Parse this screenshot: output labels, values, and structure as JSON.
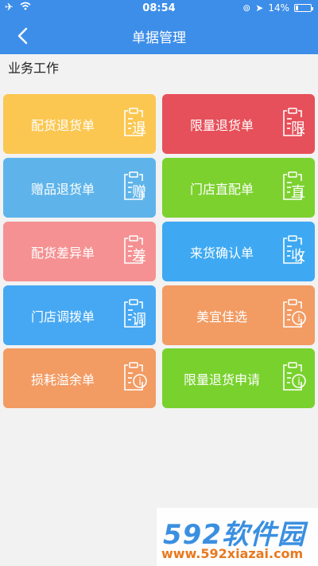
{
  "status_bar": {
    "time": "08:54",
    "battery": "14%"
  },
  "header": {
    "title": "单据管理"
  },
  "section": {
    "title": "业务工作"
  },
  "cards": [
    {
      "label": "配货退货单",
      "glyph": "退",
      "color": "#fbc751"
    },
    {
      "label": "限量退货单",
      "glyph": "限",
      "color": "#e6505a"
    },
    {
      "label": "赠品退货单",
      "glyph": "赠",
      "color": "#5eb4ea"
    },
    {
      "label": "门店直配单",
      "glyph": "直",
      "color": "#7cd12f"
    },
    {
      "label": "配货差异单",
      "glyph": "差",
      "color": "#f59192"
    },
    {
      "label": "来货确认单",
      "glyph": "收",
      "color": "#3ea9f2"
    },
    {
      "label": "门店调拨单",
      "glyph": "调",
      "color": "#46a8f2"
    },
    {
      "label": "美宜佳选",
      "glyph": "i",
      "color": "#f29b63"
    },
    {
      "label": "损耗溢余单",
      "glyph": "i",
      "color": "#f29b63"
    },
    {
      "label": "限量退货申请",
      "glyph": "i",
      "color": "#79d12e"
    }
  ],
  "watermark": {
    "logo": "592软件园",
    "url": "www.592xiazai.com"
  }
}
